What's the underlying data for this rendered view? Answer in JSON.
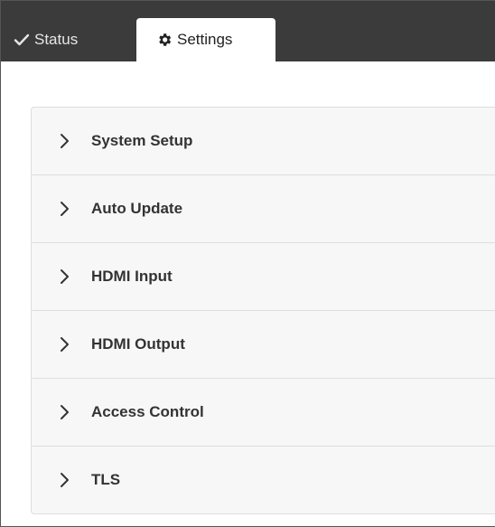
{
  "tabs": [
    {
      "label": "Status",
      "icon": "check-icon",
      "active": false
    },
    {
      "label": "Settings",
      "icon": "gear-icon",
      "active": true
    }
  ],
  "sections": [
    {
      "label": "System Setup",
      "icon": "chevron-right-icon"
    },
    {
      "label": "Auto Update",
      "icon": "chevron-right-icon"
    },
    {
      "label": "HDMI Input",
      "icon": "chevron-right-icon"
    },
    {
      "label": "HDMI Output",
      "icon": "chevron-right-icon"
    },
    {
      "label": "Access Control",
      "icon": "chevron-right-icon"
    },
    {
      "label": "TLS",
      "icon": "chevron-right-icon"
    }
  ],
  "colors": {
    "tabbar_bg": "#3b3b3b",
    "panel_bg": "#f7f7f7",
    "panel_border": "#dedede"
  }
}
